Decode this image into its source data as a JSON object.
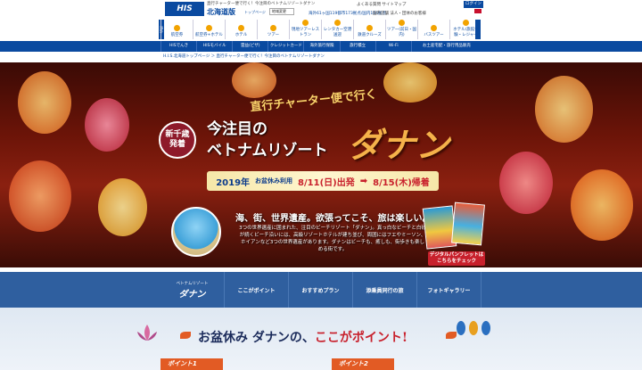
{
  "header": {
    "logo": "HIS",
    "top_title": "直行チャーター便で行く！今注目のベトナムリゾートダナン",
    "region": "北海道版",
    "top_link": "トップページ",
    "region_select": "地域変更",
    "phone": "海外61ヶ国119都市173拠点/国内164拠点",
    "links": "よくある質問  サイトマップ",
    "login": "ログイン",
    "sub_links": "国内店舗  法人・団体のお客様",
    "side_tab": "海外"
  },
  "categories": [
    {
      "label": "航空券"
    },
    {
      "label": "航空券+ホテル"
    },
    {
      "label": "ホテル"
    },
    {
      "label": "ツアー"
    },
    {
      "label": "現地ツアーレストラン"
    },
    {
      "label": "レンタカー空港送迎"
    },
    {
      "label": "鉄道クルーズ"
    },
    {
      "label": "ツアー(前日・国内)"
    },
    {
      "label": "バスツアー"
    },
    {
      "label": "ホテル/旅館体験・レジャー"
    }
  ],
  "nav": [
    "HISでんき",
    "HISモバイル",
    "雲益(ビザ)",
    "クレジットカード",
    "海外旅行保険",
    "旅行積立",
    "Wi-Fi",
    "お土産宅配・旅行用品販売"
  ],
  "breadcrumb": "H.I.S.北海道トップページ ＞ 直行チャーター便で行く！今注目のベトナムリゾートダナン",
  "hero": {
    "charter": "直行チャーター便で行く",
    "badge": "新千歳発着",
    "title_line1": "今注目の",
    "title_line2": "ベトナムリゾート",
    "title_big": "ダナン",
    "year": "2019年",
    "obon": "お盆休み利用",
    "depart": "8/11(日)出発",
    "arrow": "➡",
    "return": "8/15(木)帰着",
    "copy_title": "海、街、世界遺産。欲張ってこそ、旅は楽しい。",
    "copy_body": "3つの世界遺産に囲まれた、注目のビーチリゾート「ダナン」。真っ白なビーチと白砂が続くビーチ沿いには、高級リゾートホテルが建ち並び、周囲にはフエやミーソン、ホイアンなど3つの世界遺産があります。ダナンはビーチも、癒しも、街歩きも楽しめる街です。",
    "pamphlet_button": "デジタルパンフレットはこちらをチェック"
  },
  "section_nav": [
    {
      "small": "ベトナムリゾート",
      "label": "ダナン"
    },
    {
      "label": "ここがポイント"
    },
    {
      "label": "おすすめプラン"
    },
    {
      "label": "添乗員同行の旅"
    },
    {
      "label": "フォトギャラリー"
    }
  ],
  "points": {
    "headline_pre": "お盆休み",
    "headline_mid": "ダナンの、",
    "headline_hl": "ここがポイント!",
    "point1": "ポイント1",
    "point2": "ポイント2"
  },
  "colors": {
    "brand_blue": "#0a4aa0",
    "accent_red": "#c8202c",
    "section_blue": "#2f5f9f"
  }
}
